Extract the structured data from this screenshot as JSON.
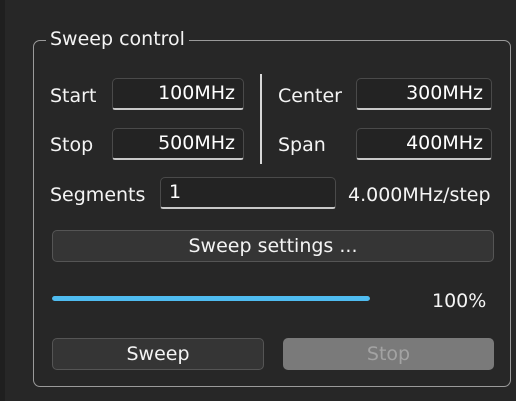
{
  "group": {
    "title": "Sweep control"
  },
  "start": {
    "label": "Start",
    "value": "100MHz"
  },
  "stop": {
    "label": "Stop",
    "value": "500MHz"
  },
  "center": {
    "label": "Center",
    "value": "300MHz"
  },
  "span": {
    "label": "Span",
    "value": "400MHz"
  },
  "segments": {
    "label": "Segments",
    "value": "1",
    "step_text": "4.000MHz/step"
  },
  "buttons": {
    "sweep_settings": "Sweep settings ...",
    "sweep": "Sweep",
    "stop": "Stop"
  },
  "progress": {
    "fraction": 1.0,
    "text": "100%"
  },
  "colors": {
    "progress_fill": "#4fbcf0",
    "disabled_button": "#7a7a7a"
  }
}
